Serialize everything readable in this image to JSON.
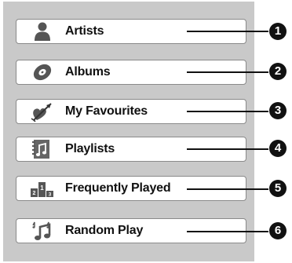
{
  "menu": {
    "items": [
      {
        "label": "Artists",
        "icon": "person-icon",
        "callout": "1"
      },
      {
        "label": "Albums",
        "icon": "disc-icon",
        "callout": "2"
      },
      {
        "label": "My Favourites",
        "icon": "heart-arrow-icon",
        "callout": "3"
      },
      {
        "label": "Playlists",
        "icon": "playlist-icon",
        "callout": "4"
      },
      {
        "label": "Frequently Played",
        "icon": "podium-icon",
        "callout": "5"
      },
      {
        "label": "Random Play",
        "icon": "shuffle-notes-icon",
        "callout": "6"
      }
    ]
  },
  "colors": {
    "panel_background": "#c9c9c9",
    "item_background": "#ffffff",
    "item_border": "#8a8a8a",
    "icon_fill": "#555555",
    "callout": "#111111"
  }
}
